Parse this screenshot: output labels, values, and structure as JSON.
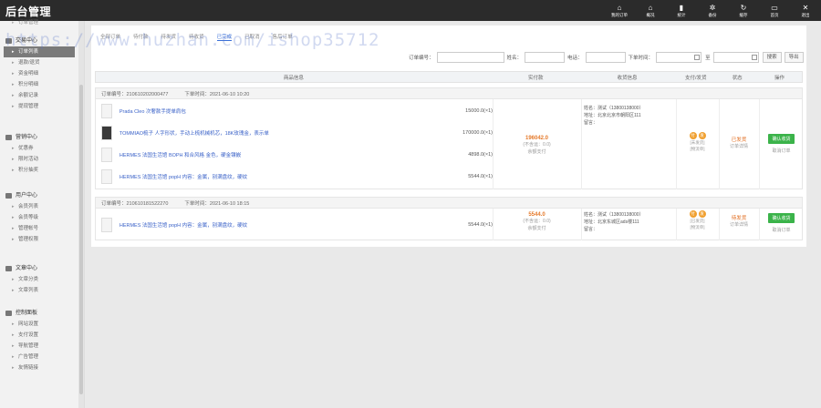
{
  "header": {
    "brand": "后台管理",
    "nav": [
      {
        "icon": "home-icon",
        "glyph": "⌂",
        "label": "我的订单"
      },
      {
        "icon": "home-icon",
        "glyph": "⌂",
        "label": "概况"
      },
      {
        "icon": "bar-chart-icon",
        "glyph": "▮",
        "label": "统计"
      },
      {
        "icon": "settings-icon",
        "glyph": "✲",
        "label": "备份"
      },
      {
        "icon": "refresh-icon",
        "glyph": "↻",
        "label": "缓存"
      },
      {
        "icon": "monitor-icon",
        "glyph": "▭",
        "label": "首页"
      },
      {
        "icon": "close-icon",
        "glyph": "✕",
        "label": "退出"
      }
    ]
  },
  "watermark": "https://www.huzhan.com/ishop35712",
  "sidebar": {
    "groups": [
      {
        "title": "",
        "items": [
          {
            "label": "订单管理"
          }
        ]
      },
      {
        "title": "交易中心",
        "items": [
          {
            "label": "订单列表"
          },
          {
            "label": "退款/退货"
          },
          {
            "label": "资金明细"
          },
          {
            "label": "积分明细"
          },
          {
            "label": "余额记录"
          },
          {
            "label": "提现管理"
          }
        ]
      },
      {
        "title": "营销中心",
        "items": [
          {
            "label": "优惠券"
          },
          {
            "label": "限时活动"
          },
          {
            "label": "积分抽奖"
          }
        ]
      },
      {
        "title": "用户中心",
        "items": [
          {
            "label": "会员列表"
          },
          {
            "label": "会员等级"
          },
          {
            "label": "管理帐号"
          },
          {
            "label": "管理权限"
          }
        ]
      },
      {
        "title": "文章中心",
        "items": [
          {
            "label": "文章分类"
          },
          {
            "label": "文章列表"
          }
        ]
      },
      {
        "title": "控制面板",
        "items": [
          {
            "label": "网站设置"
          },
          {
            "label": "支付设置"
          },
          {
            "label": "导航管理"
          },
          {
            "label": "广告管理"
          },
          {
            "label": "友情链接"
          }
        ]
      }
    ]
  },
  "tabs": [
    "全部订单",
    "待付款",
    "待发货",
    "待收货",
    "已完成",
    "已取消",
    "售后订单"
  ],
  "active_tab_index": 4,
  "filters": {
    "order_no_label": "订单编号：",
    "name_label": "姓名：",
    "phone_label": "电话：",
    "date_label": "下单时间：",
    "to_label": "至",
    "search_button": "搜索",
    "export_button": "导出"
  },
  "table_headers": [
    "商品信息",
    "实付款",
    "收货信息",
    "支付/发货",
    "状态",
    "操作"
  ],
  "orders": [
    {
      "order_no": "订单编号：210610202000477",
      "time": "下单时间：2021-06-10 10:20",
      "items": [
        {
          "name": "Prada Cleo 次奢款手提单肩包",
          "price": "15000.0(×1)",
          "thumb": "light"
        },
        {
          "name": "TOMMIAO梳子 人字形状，手动上梳机械机芯，18K玫瑰金，表示单",
          "price": "170000.0(×1)",
          "thumb": "dark"
        },
        {
          "name": "HERMES 法国生活馆 BOPH 和合风格 金色，硬金镶嵌",
          "price": "4898.0(×1)",
          "thumb": "light"
        },
        {
          "name": "HERMES 法国生活馆 popH 内容：金属，别满盘纹，硬纹",
          "price": "5544.0(×1)",
          "thumb": "light"
        }
      ],
      "pay_amount": "196042.0",
      "pay_sub1": "(不含运：0.0)",
      "pay_sub2": "余额支付",
      "addr_name": "姓名：测试（13800138000）",
      "addr_region": "地址：北京北京市朝阳区111",
      "addr_note": "留言：",
      "ship_sub1": "[未发货]",
      "ship_sub2": "[物流单]",
      "status": "已发货",
      "status_sub": "订单详情",
      "op_button": "确认收货",
      "op_sub": "取消订单"
    },
    {
      "order_no": "订单编号：210610181522270",
      "time": "下单时间：2021-06-10 18:15",
      "items": [
        {
          "name": "HERMES 法国生活馆 popH 内容：金属，别满盘纹，硬纹",
          "price": "5544.0(×1)",
          "thumb": "light"
        }
      ],
      "pay_amount": "5544.0",
      "pay_sub1": "(不含运：0.0)",
      "pay_sub2": "余额支付",
      "addr_name": "姓名：测试（13800138000）",
      "addr_region": "地址：北京东城区ads楼111",
      "addr_note": "留言：",
      "ship_sub1": "[已发货]",
      "ship_sub2": "[物流单]",
      "status": "待发货",
      "status_sub": "订单详情",
      "op_button": "确认收货",
      "op_sub": "取消订单"
    }
  ]
}
